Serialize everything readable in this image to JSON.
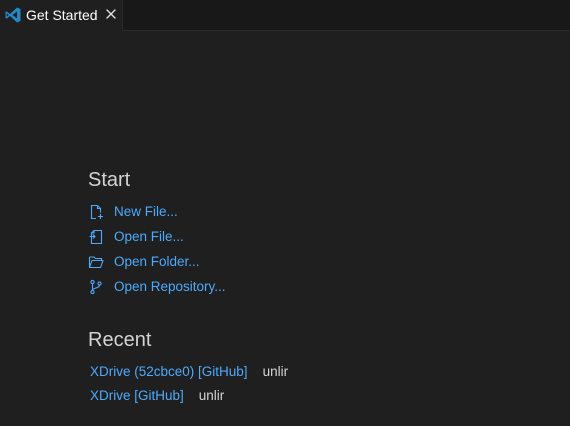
{
  "tab": {
    "label": "Get Started"
  },
  "start": {
    "title": "Start",
    "items": [
      {
        "label": "New File...",
        "icon": "new-file-icon"
      },
      {
        "label": "Open File...",
        "icon": "open-file-icon"
      },
      {
        "label": "Open Folder...",
        "icon": "folder-icon"
      },
      {
        "label": "Open Repository...",
        "icon": "git-branch-icon"
      }
    ]
  },
  "recent": {
    "title": "Recent",
    "items": [
      {
        "name": "XDrive (52cbce0) [GitHub]",
        "path": "unlir"
      },
      {
        "name": "XDrive [GitHub]",
        "path": "unlir"
      }
    ]
  },
  "colors": {
    "background": "#1f1f1f",
    "tabbar": "#181818",
    "link": "#4daafc",
    "text": "#d4d4d4",
    "vscode_blue": "#2489ca"
  }
}
